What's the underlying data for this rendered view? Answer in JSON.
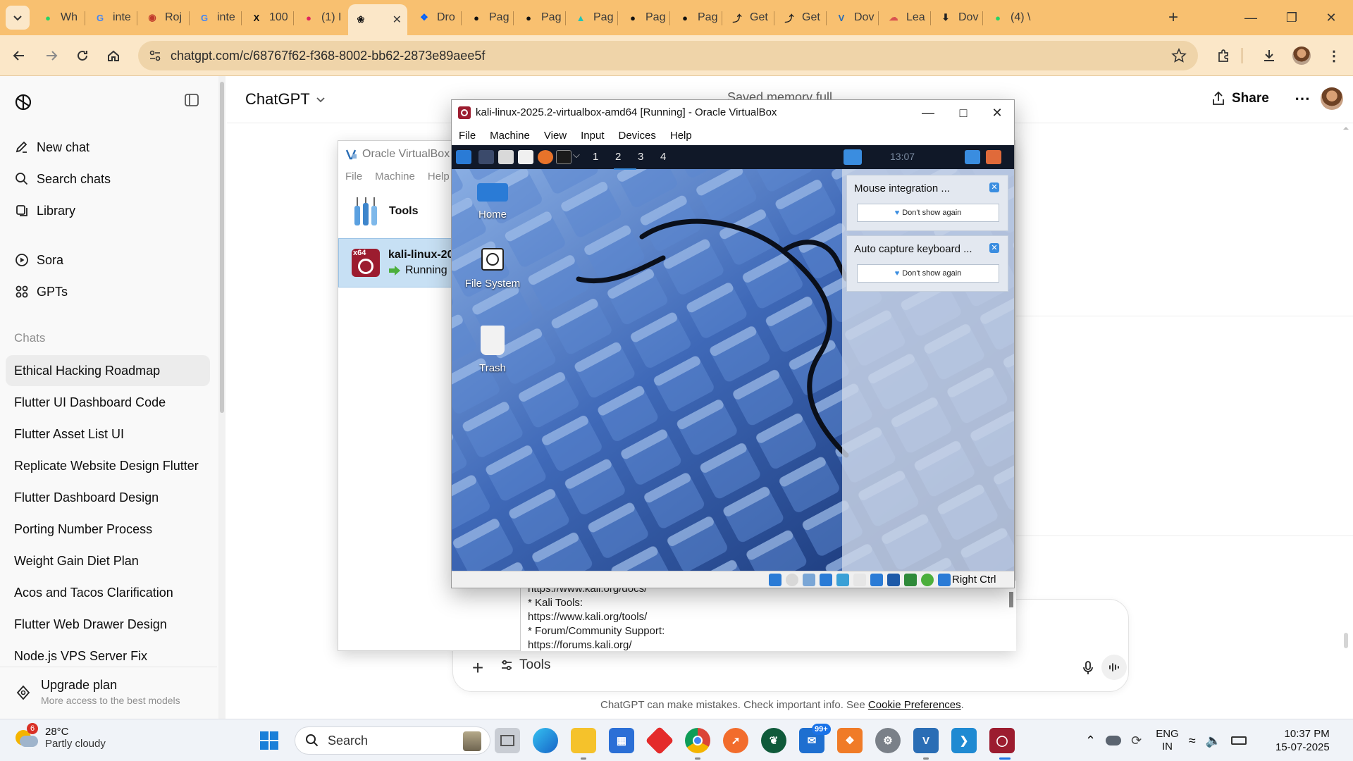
{
  "browser": {
    "tabs": [
      {
        "label": "Wh",
        "icon": "whatsapp-icon"
      },
      {
        "label": "inte",
        "icon": "google-icon"
      },
      {
        "label": "Roj",
        "icon": "roj-icon"
      },
      {
        "label": "inte",
        "icon": "google-icon"
      },
      {
        "label": "100",
        "icon": "x-icon"
      },
      {
        "label": "(1) I",
        "icon": "app-icon"
      },
      {
        "label": "",
        "icon": "chatgpt-icon"
      },
      {
        "label": "Dro",
        "icon": "dropbox-icon"
      },
      {
        "label": "Pag",
        "icon": "github-icon"
      },
      {
        "label": "Pag",
        "icon": "github-icon"
      },
      {
        "label": "Pag",
        "icon": "netlify-icon"
      },
      {
        "label": "Pag",
        "icon": "github-icon"
      },
      {
        "label": "Pag",
        "icon": "github-icon"
      },
      {
        "label": "Get",
        "icon": "git-icon"
      },
      {
        "label": "Get",
        "icon": "git-icon"
      },
      {
        "label": "Dov",
        "icon": "vbox-icon"
      },
      {
        "label": "Lea",
        "icon": "cloud-icon"
      },
      {
        "label": "Dov",
        "icon": "download-icon"
      },
      {
        "label": "(4) \\",
        "icon": "whatsapp-icon"
      }
    ],
    "url": "chatgpt.com/c/68767f62-f368-8002-bb62-2873e89aee5f"
  },
  "sidebar": {
    "nav": [
      {
        "label": "New chat",
        "icon": "edit-icon"
      },
      {
        "label": "Search chats",
        "icon": "search-icon"
      },
      {
        "label": "Library",
        "icon": "library-icon"
      }
    ],
    "extras": [
      {
        "label": "Sora",
        "icon": "play-icon"
      },
      {
        "label": "GPTs",
        "icon": "grid-icon"
      }
    ],
    "chats_heading": "Chats",
    "chats": [
      "Ethical Hacking Roadmap",
      "Flutter UI Dashboard Code",
      "Flutter Asset List UI",
      "Replicate Website Design Flutter",
      "Flutter Dashboard Design",
      "Porting Number Process",
      "Weight Gain Diet Plan",
      "Acos and Tacos Clarification",
      "Flutter Web Drawer Design",
      "Node.js VPS Server Fix"
    ],
    "upgrade": {
      "title": "Upgrade plan",
      "subtitle": "More access to the best models"
    }
  },
  "main": {
    "model": "ChatGPT",
    "memory_notice": "Saved memory full",
    "share_label": "Share",
    "composer": {
      "tools_label": "Tools"
    },
    "disclaimer": "ChatGPT can make mistakes. Check important info. See",
    "disclaimer_link": "Cookie Preferences"
  },
  "vbox_manager": {
    "title": "Oracle VirtualBox M",
    "menu": [
      "File",
      "Machine",
      "Help"
    ],
    "tools_label": "Tools",
    "vm": {
      "name": "kali-linux-20",
      "state": "Running",
      "badge": "x64"
    },
    "output_lines": [
      "https://www.kali.org/docs/",
      "* Kali Tools:",
      "https://www.kali.org/tools/",
      "* Forum/Community Support:",
      "https://forums.kali.org/"
    ]
  },
  "vm_window": {
    "title": "kali-linux-2025.2-virtualbox-amd64 [Running] - Oracle VirtualBox",
    "menu": [
      "File",
      "Machine",
      "View",
      "Input",
      "Devices",
      "Help"
    ],
    "workspaces": [
      "1",
      "2",
      "3",
      "4"
    ],
    "clock": "13:07",
    "desktop_icons": [
      "Home",
      "File System",
      "Trash"
    ],
    "notifications": [
      {
        "title": "Mouse integration ...",
        "button": "Don't show again"
      },
      {
        "title": "Auto capture keyboard ...",
        "button": "Don't show again"
      }
    ],
    "host_key": "Right Ctrl"
  },
  "taskbar": {
    "weather": {
      "temp": "28°C",
      "desc": "Partly cloudy",
      "badge": "6"
    },
    "search_placeholder": "Search",
    "store_badge": "99+",
    "language": {
      "line1": "ENG",
      "line2": "IN"
    },
    "time": "10:37 PM",
    "date": "15-07-2025"
  },
  "colors": {
    "tabstrip": "#f8c070",
    "toolbar": "#fbe7c8",
    "sidebar": "#f9f9f9",
    "vm_selected": "#c7e0f4",
    "kali_panel": "#101828",
    "taskbar": "#f0f3f8"
  }
}
